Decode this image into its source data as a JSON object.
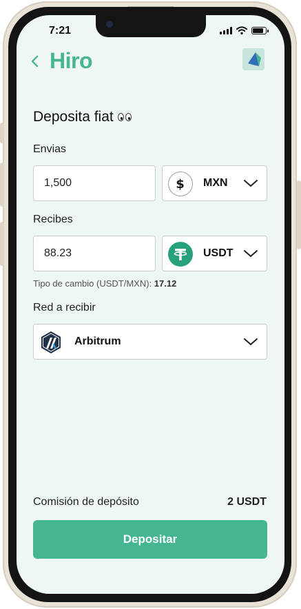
{
  "status_bar": {
    "time": "7:21"
  },
  "header": {
    "brand": "Hiro"
  },
  "title": {
    "text": "Deposita fiat"
  },
  "send": {
    "label": "Envias",
    "amount": "1,500",
    "currency": "MXN",
    "currency_icon": "dollar-icon"
  },
  "receive": {
    "label": "Recibes",
    "amount": "88.23",
    "currency": "USDT",
    "currency_icon": "tether-icon",
    "currency_color": "#26a17b"
  },
  "exchange_rate": {
    "label": "Tipo de cambio (USDT/MXN): ",
    "value": "17.12"
  },
  "network": {
    "label": "Red a recibir",
    "selected": "Arbitrum",
    "icon": "arbitrum-icon"
  },
  "fee": {
    "label": "Comisión de depósito",
    "value": "2 USDT"
  },
  "cta": {
    "label": "Depositar"
  },
  "colors": {
    "accent": "#46b592",
    "screen_bg": "#eef7f3"
  }
}
